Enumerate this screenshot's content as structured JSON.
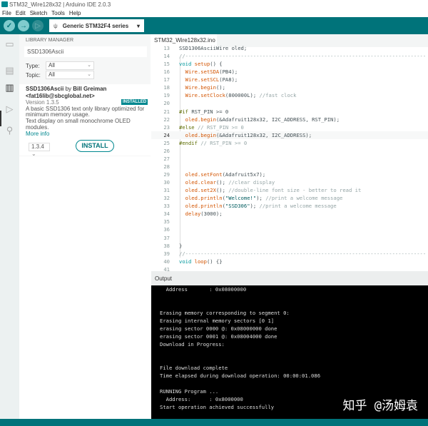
{
  "window": {
    "title": "STM32_Wire128x32 | Arduino IDE 2.0.3"
  },
  "menu": [
    "File",
    "Edit",
    "Sketch",
    "Tools",
    "Help"
  ],
  "toolbar": {
    "board": "Generic STM32F4 series",
    "accent": "#00737a"
  },
  "library": {
    "heading": "LIBRARY MANAGER",
    "search": "SSD1306Ascii",
    "type_label": "Type:",
    "type_value": "All",
    "topic_label": "Topic:",
    "topic_value": "All",
    "name": "SSD1306Ascii",
    "by": " by ",
    "author": "Bill Greiman",
    "email": "<fat16lib@sbcglobal.net>",
    "version": "Version 1.3.5",
    "badge": "INSTALLED",
    "desc1": "A basic SSD1306 text only library optimized for minimum memory usage.",
    "desc2": "Text display on small monochrome OLED modules.",
    "more": "More info",
    "select_version": "1.3.4",
    "install": "INSTALL"
  },
  "editor": {
    "tab": "STM32_Wire128x32.ino",
    "current_line": 24,
    "lines": [
      {
        "n": "13",
        "t": [
          [
            "SSD1306AsciiWire oled;",
            "tx"
          ]
        ]
      },
      {
        "n": "14",
        "t": [
          [
            "//------------------------------------------------------------------------------",
            "cm"
          ]
        ]
      },
      {
        "n": "15",
        "t": [
          [
            "void ",
            "kw"
          ],
          [
            "setup",
            "fn"
          ],
          [
            "() {",
            "tx"
          ]
        ]
      },
      {
        "n": "16",
        "t": [
          [
            "  Wire.",
            "fn"
          ],
          [
            "setSDA",
            "fn"
          ],
          [
            "(PB4);",
            "tx"
          ]
        ]
      },
      {
        "n": "17",
        "t": [
          [
            "  Wire.",
            "fn"
          ],
          [
            "setSCL",
            "fn"
          ],
          [
            "(PA8);",
            "tx"
          ]
        ]
      },
      {
        "n": "18",
        "t": [
          [
            "  Wire.",
            "fn"
          ],
          [
            "begin",
            "fn"
          ],
          [
            "();",
            "tx"
          ]
        ]
      },
      {
        "n": "19",
        "t": [
          [
            "  Wire.",
            "fn"
          ],
          [
            "setClock",
            "fn"
          ],
          [
            "(800000L); ",
            "tx"
          ],
          [
            "//fast clock",
            "cm"
          ]
        ]
      },
      {
        "n": "20",
        "t": []
      },
      {
        "n": "21",
        "t": [
          [
            "#if ",
            "pp"
          ],
          [
            "RST_PIN >= 0",
            "tx"
          ]
        ]
      },
      {
        "n": "22",
        "t": [
          [
            "  oled.",
            "fn"
          ],
          [
            "begin",
            "fn"
          ],
          [
            "(&Adafruit128x32, I2C_ADDRESS, RST_PIN);",
            "tx"
          ]
        ]
      },
      {
        "n": "23",
        "t": [
          [
            "#else ",
            "pp"
          ],
          [
            "// RST_PIN >= 0",
            "cm"
          ]
        ]
      },
      {
        "n": "24",
        "t": [
          [
            "  oled.",
            "fn"
          ],
          [
            "begin",
            "fn"
          ],
          [
            "(&Adafruit128x32, I2C_ADDRESS);",
            "tx"
          ]
        ]
      },
      {
        "n": "25",
        "t": [
          [
            "#endif ",
            "pp"
          ],
          [
            "// RST_PIN >= 0",
            "cm"
          ]
        ]
      },
      {
        "n": "26",
        "t": []
      },
      {
        "n": "27",
        "t": []
      },
      {
        "n": "28",
        "t": []
      },
      {
        "n": "29",
        "t": [
          [
            "  oled.",
            "fn"
          ],
          [
            "setFont",
            "fn"
          ],
          [
            "(Adafruit5x7);",
            "tx"
          ]
        ]
      },
      {
        "n": "30",
        "t": [
          [
            "  oled.",
            "fn"
          ],
          [
            "clear",
            "fn"
          ],
          [
            "(); ",
            "tx"
          ],
          [
            "//clear display",
            "cm"
          ]
        ]
      },
      {
        "n": "31",
        "t": [
          [
            "  oled.",
            "fn"
          ],
          [
            "set2X",
            "fn"
          ],
          [
            "(); ",
            "tx"
          ],
          [
            "//double-line font size - better to read it",
            "cm"
          ]
        ]
      },
      {
        "n": "32",
        "t": [
          [
            "  oled.",
            "fn"
          ],
          [
            "println",
            "fn"
          ],
          [
            "(",
            "tx"
          ],
          [
            "\"Welcome!\"",
            "st"
          ],
          [
            "); ",
            "tx"
          ],
          [
            "//print a welcome message",
            "cm"
          ]
        ]
      },
      {
        "n": "33",
        "t": [
          [
            "  oled.",
            "fn"
          ],
          [
            "println",
            "fn"
          ],
          [
            "(",
            "tx"
          ],
          [
            "\"SSD306\"",
            "st"
          ],
          [
            "); ",
            "tx"
          ],
          [
            "//print a welcome message",
            "cm"
          ]
        ]
      },
      {
        "n": "34",
        "t": [
          [
            "  ",
            "tx"
          ],
          [
            "delay",
            "fn"
          ],
          [
            "(3000);",
            "tx"
          ]
        ]
      },
      {
        "n": "35",
        "t": []
      },
      {
        "n": "36",
        "t": []
      },
      {
        "n": "37",
        "t": []
      },
      {
        "n": "38",
        "t": [
          [
            "}",
            "tx"
          ]
        ]
      },
      {
        "n": "39",
        "t": [
          [
            "//------------------------------------------------------------------------------",
            "cm"
          ]
        ]
      },
      {
        "n": "40",
        "t": [
          [
            "void ",
            "kw"
          ],
          [
            "loop",
            "fn"
          ],
          [
            "() {}",
            "tx"
          ]
        ]
      },
      {
        "n": "41",
        "t": []
      }
    ]
  },
  "output": {
    "title": "Output",
    "lines": [
      "  Address       : 0x08000000",
      "",
      "",
      "Erasing memory corresponding to segment 0:",
      "Erasing internal memory sectors [0 1]",
      "erasing sector 0000 @: 0x08000000 done",
      "erasing sector 0001 @: 0x08004000 done",
      "Download in Progress:",
      "",
      "",
      "File download complete",
      "Time elapsed during download operation: 00:00:01.086",
      "",
      "RUNNING Program ...",
      "  Address:      : 0x8000000",
      "Start operation achieved successfully"
    ]
  },
  "watermark": "知乎 @汤姆袁"
}
